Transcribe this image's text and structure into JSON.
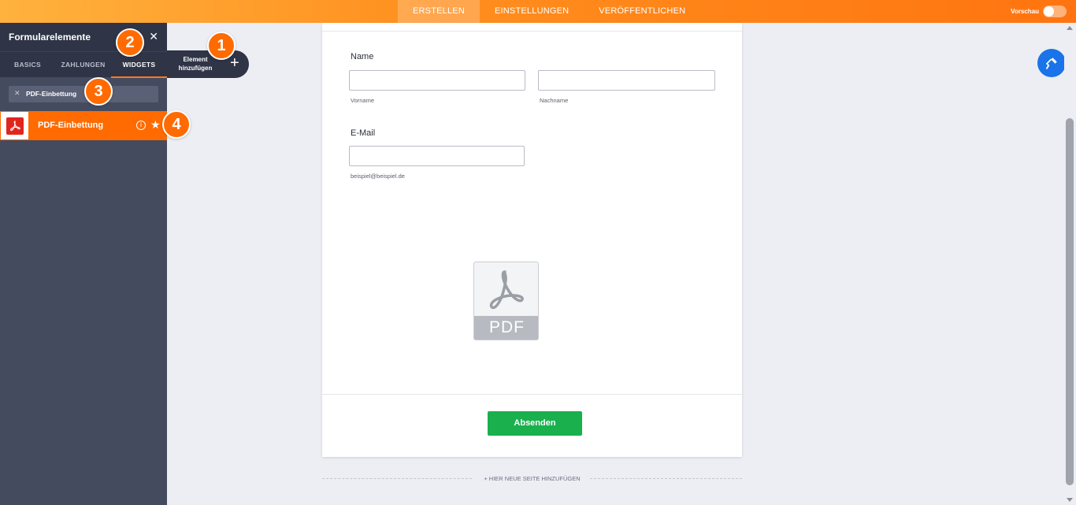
{
  "topbar": {
    "tabs": [
      {
        "label": "ERSTELLEN",
        "active": true
      },
      {
        "label": "EINSTELLUNGEN",
        "active": false
      },
      {
        "label": "VERÖFFENTLICHEN",
        "active": false
      }
    ],
    "preview_label": "Vorschau",
    "preview_on": false
  },
  "sidebar": {
    "title": "Formularelemente",
    "close_icon": "close-icon",
    "tabs": [
      {
        "label": "BASICS",
        "active": false
      },
      {
        "label": "ZAHLUNGEN",
        "active": false
      },
      {
        "label": "WIDGETS",
        "active": true
      }
    ],
    "search": {
      "value": "PDF-Einbettung",
      "clear_icon": "clear-icon"
    },
    "results": [
      {
        "label": "PDF-Einbettung",
        "icon": "pdf-icon",
        "highlighted": true
      }
    ]
  },
  "add_element": {
    "line1": "Element",
    "line2": "hinzufügen",
    "icon": "plus-icon"
  },
  "callouts": [
    "1",
    "2",
    "3",
    "4"
  ],
  "form": {
    "name": {
      "label": "Name",
      "first_sublabel": "Vorname",
      "last_sublabel": "Nachname"
    },
    "email": {
      "label": "E-Mail",
      "sublabel": "beispiel@beispiel.de"
    },
    "pdf_embed": {
      "badge_text": "PDF",
      "icon": "pdf-document-icon"
    },
    "submit_label": "Absenden",
    "add_page_label": "+ HIER NEUE SEITE HINZUFÜGEN"
  },
  "colors": {
    "accent": "#ff6b00",
    "sidebar_bg": "#454b5f",
    "sidebar_header": "#2f3446",
    "submit": "#19b04d",
    "designer_button": "#1a73e8"
  }
}
